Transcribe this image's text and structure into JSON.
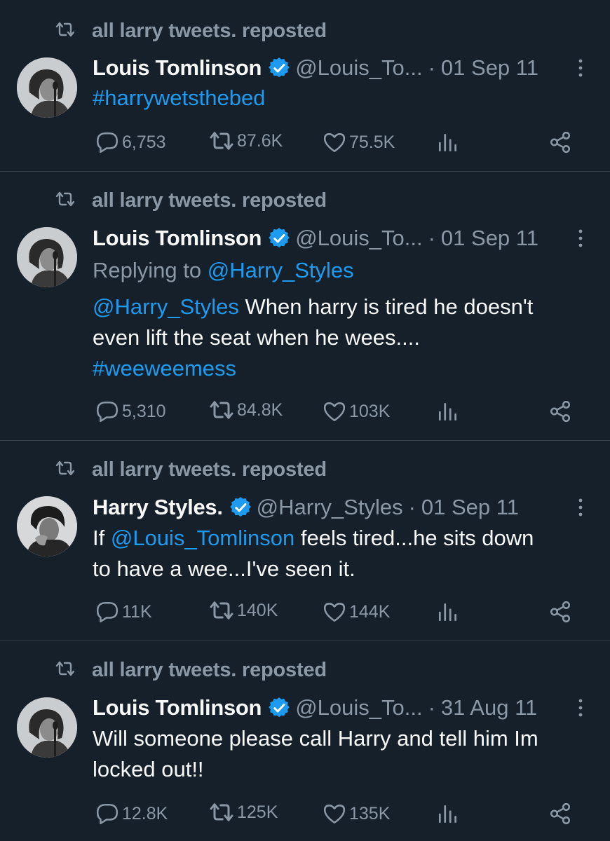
{
  "colors": {
    "background": "#15202b",
    "divider": "#38444d",
    "text": "#f7f9f9",
    "muted": "#8b98a5",
    "link": "#1d9bf0",
    "verified": "#1d9bf0"
  },
  "icons": [
    "retweet-icon",
    "verified-badge-icon",
    "more-icon",
    "reply-icon",
    "like-icon",
    "views-icon",
    "share-icon"
  ],
  "tweets": [
    {
      "repost_label": "all larry tweets. reposted",
      "name": "Louis Tomlinson",
      "handle": "@Louis_To...",
      "dot": "·",
      "date": "01 Sep 11",
      "body": "#harrywetsthebed",
      "stats": {
        "replies": "6,753",
        "reposts": "87.6K",
        "likes": "75.5K"
      }
    },
    {
      "repost_label": "all larry tweets. reposted",
      "name": "Louis Tomlinson",
      "handle": "@Louis_To...",
      "dot": "·",
      "date": "01 Sep 11",
      "replying_prefix": "Replying to ",
      "replying_handle": "@Harry_Styles",
      "mention": "@Harry_Styles",
      "body_part1": " When harry is tired he doesn't",
      "body_line2": "even lift the seat when he wees....",
      "hashtag": "#weeweemess",
      "stats": {
        "replies": "5,310",
        "reposts": "84.8K",
        "likes": "103K"
      }
    },
    {
      "repost_label": "all larry tweets. reposted",
      "name": "Harry Styles.",
      "handle": "@Harry_Styles",
      "dot": "·",
      "date": "01 Sep 11",
      "body_prefix": "If ",
      "mention": "@Louis_Tomlinson",
      "body_part1": " feels tired...he sits down",
      "body_line2": "to have a wee...I've seen it.",
      "stats": {
        "replies": "11K",
        "reposts": "140K",
        "likes": "144K"
      }
    },
    {
      "repost_label": "all larry tweets. reposted",
      "name": "Louis Tomlinson",
      "handle": "@Louis_To...",
      "dot": "·",
      "date": "31 Aug 11",
      "body_line1": "Will someone please call Harry and tell him Im",
      "body_line2": "locked out!!",
      "stats": {
        "replies": "12.8K",
        "reposts": "125K",
        "likes": "135K"
      }
    }
  ]
}
